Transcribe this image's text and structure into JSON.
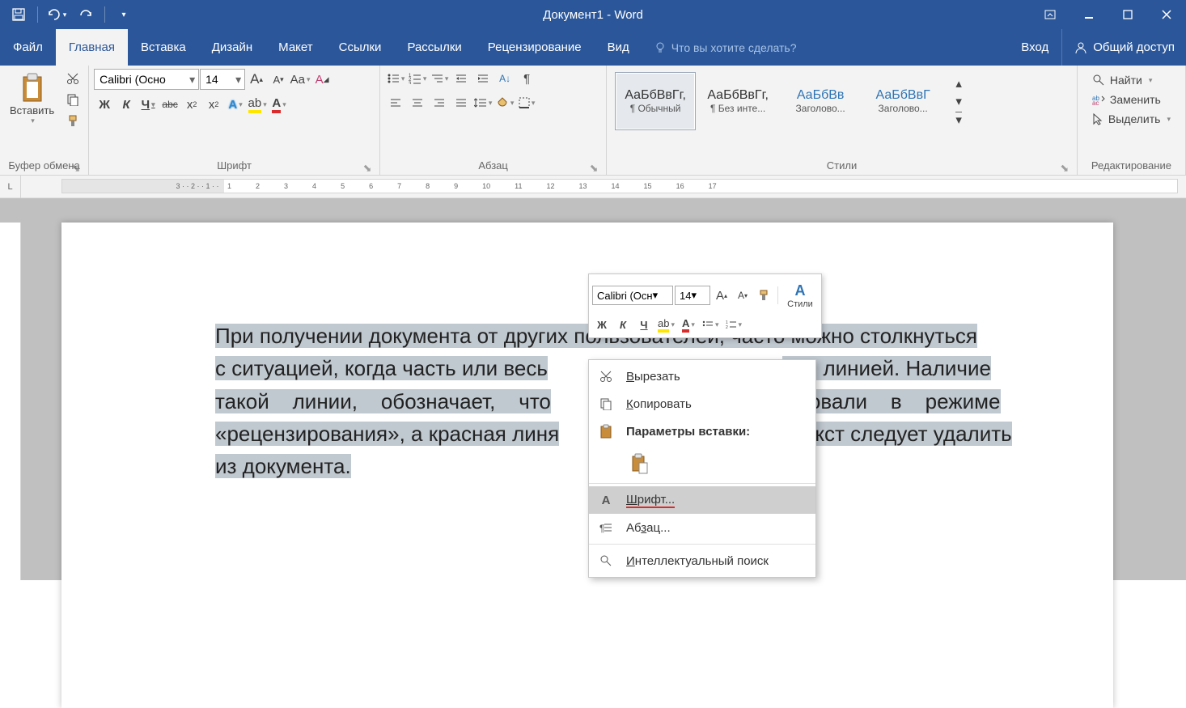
{
  "title": "Документ1 - Word",
  "tabs": {
    "file": "Файл",
    "home": "Главная",
    "insert": "Вставка",
    "design": "Дизайн",
    "layout": "Макет",
    "references": "Ссылки",
    "mailings": "Рассылки",
    "review": "Рецензирование",
    "view": "Вид"
  },
  "tell_me": "Что вы хотите сделать?",
  "sign_in": "Вход",
  "share": "Общий доступ",
  "groups": {
    "clipboard": {
      "label": "Буфер обмена",
      "paste": "Вставить"
    },
    "font": {
      "label": "Шрифт",
      "name": "Calibri (Осно",
      "size": "14"
    },
    "paragraph": {
      "label": "Абзац"
    },
    "styles": {
      "label": "Стили",
      "items": [
        {
          "preview": "АаБбВвГг,",
          "name": "¶ Обычный"
        },
        {
          "preview": "АаБбВвГг,",
          "name": "¶ Без инте..."
        },
        {
          "preview": "АаБбВв",
          "name": "Заголово..."
        },
        {
          "preview": "АаБбВвГ",
          "name": "Заголово..."
        }
      ]
    },
    "editing": {
      "label": "Редактирование",
      "find": "Найти",
      "replace": "Заменить",
      "select": "Выделить"
    }
  },
  "font_buttons": {
    "bold": "Ж",
    "italic": "К",
    "underline": "Ч",
    "strike": "abc",
    "sub": "x",
    "sup": "x"
  },
  "ruler": {
    "corner": "L",
    "neg": [
      "3",
      "2",
      "1"
    ],
    "pos": [
      "1",
      "2",
      "3",
      "4",
      "5",
      "6",
      "7",
      "8",
      "9",
      "10",
      "11",
      "12",
      "13",
      "14",
      "15",
      "16",
      "17"
    ]
  },
  "doc": {
    "l1a": "При получении документа от других пользователей, часто можно столкнуться",
    "l2a": "с ситуацией, когда часть или весь",
    "l2b": "ной линией. Наличие",
    "l3a": "такой    линии,    обозначает,    что",
    "l3b": "ировали    в    режиме",
    "l4a": "«рецензирования», а красная линя",
    "l4b": "текст следует удалить",
    "l5": "из документа."
  },
  "mini": {
    "font": "Calibri (Осн",
    "size": "14",
    "styles": "Стили",
    "bold": "Ж",
    "italic": "К",
    "underline": "Ч"
  },
  "cmenu": {
    "cut": "Вырезать",
    "copy": "Копировать",
    "paste_label": "Параметры вставки:",
    "font": "Шрифт...",
    "paragraph": "Абзац...",
    "smart": "Интеллектуальный поиск"
  }
}
